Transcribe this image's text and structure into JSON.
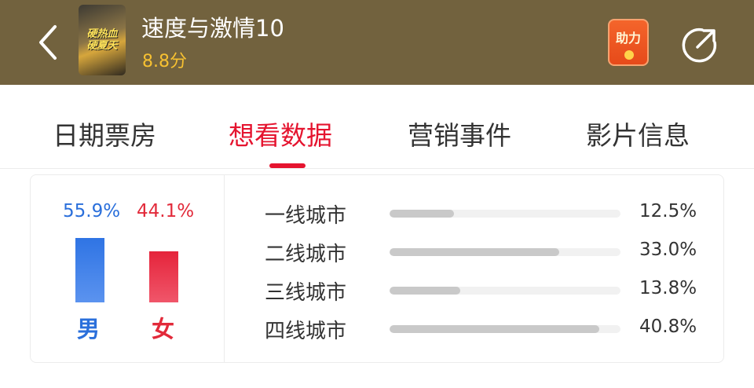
{
  "header": {
    "title": "速度与激情10",
    "rating": "8.8分",
    "poster_text_line1": "硬热血",
    "poster_text_line2": "硬夏天",
    "boost_label": "助力",
    "background_color": "#72623e",
    "back_icon": "chevron-left-icon",
    "share_icon": "share-icon"
  },
  "tabs": [
    {
      "label": "日期票房",
      "active": false
    },
    {
      "label": "想看数据",
      "active": true
    },
    {
      "label": "营销事件",
      "active": false
    },
    {
      "label": "影片信息",
      "active": false
    }
  ],
  "gender": {
    "male": {
      "percent": "55.9%",
      "label": "男",
      "value": 55.9,
      "color": "#2a6fdb"
    },
    "female": {
      "percent": "44.1%",
      "label": "女",
      "value": 44.1,
      "color": "#e22a3a"
    }
  },
  "cities": [
    {
      "name": "一线城市",
      "percent": "12.5%",
      "value": 12.5
    },
    {
      "name": "二线城市",
      "percent": "33.0%",
      "value": 33.0
    },
    {
      "name": "三线城市",
      "percent": "13.8%",
      "value": 13.8
    },
    {
      "name": "四线城市",
      "percent": "40.8%",
      "value": 40.8
    }
  ],
  "accent_color": "#e5142f"
}
